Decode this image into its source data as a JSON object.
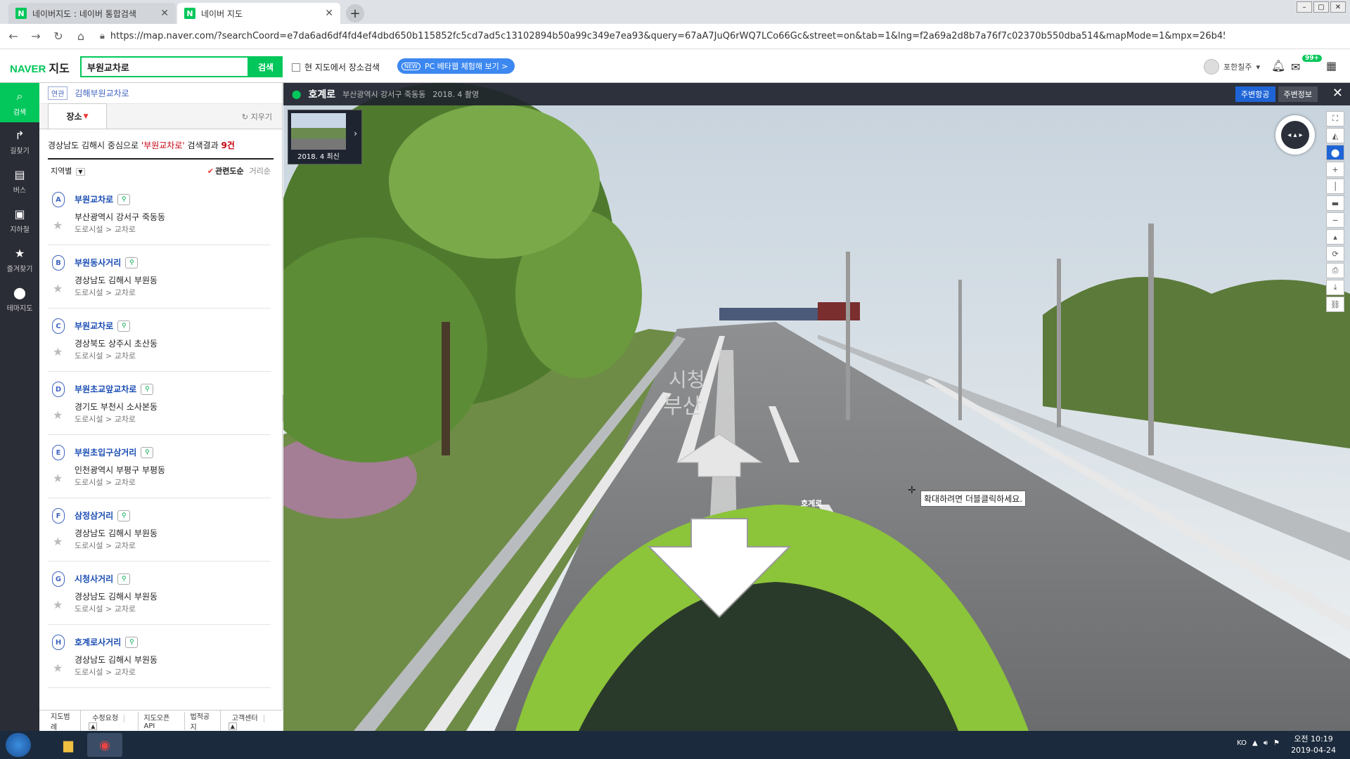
{
  "browser": {
    "tabs": [
      {
        "title": "네이버지도 : 네이버 통합검색",
        "active": false
      },
      {
        "title": "네이버 지도",
        "active": true
      }
    ],
    "url": "https://map.naver.com/?searchCoord=e7da6ad6df4fd4ef4dbd650b115852fc5cd7ad5c13102894b50a99c349e7ea93&query=67aA7JuQ6rWQ7LCo66Gc&street=on&tab=1&lng=f2a69a2d8b7a76f7c02370b550dba514&mapMode=1&mpx=26b45c..."
  },
  "header": {
    "logo": "NAVER",
    "logo_suffix": "지도",
    "search_value": "부원교차로",
    "search_button": "검색",
    "checkbox_label": "현 지도에서 장소검색",
    "beta_badge": "NEW",
    "beta_label": "PC 베타웹 체험해 보기 >",
    "user_name": "포한칠주",
    "mail_badge": "99+"
  },
  "leftnav": [
    {
      "icon": "search-icon",
      "glyph": "⌕",
      "label": "검색"
    },
    {
      "icon": "directions-icon",
      "glyph": "↱",
      "label": "길찾기"
    },
    {
      "icon": "bus-icon",
      "glyph": "▤",
      "label": "버스"
    },
    {
      "icon": "subway-icon",
      "glyph": "▣",
      "label": "지하철"
    },
    {
      "icon": "star-icon",
      "glyph": "★",
      "label": "즐겨찾기"
    },
    {
      "icon": "pin-icon",
      "glyph": "⬤",
      "label": "테마지도"
    }
  ],
  "panel": {
    "related_tag": "연관",
    "related_text": "김해부원교차로",
    "tab_label": "장소",
    "clear_label": "지우기",
    "summary_prefix": "경상남도 김해시 중심으로 ",
    "summary_query": "'부원교차로'",
    "summary_mid": " 검색결과 ",
    "summary_count": "9건",
    "filter_label": "지역별",
    "sort_relevance": "관련도순",
    "sort_distance": "거리순",
    "results": [
      {
        "marker": "A",
        "name": "부원교차로",
        "address": "부산광역시 강서구 죽동동",
        "category": "도로시설 > 교차로"
      },
      {
        "marker": "B",
        "name": "부원동사거리",
        "address": "경상남도 김해시 부원동",
        "category": "도로시설 > 교차로"
      },
      {
        "marker": "C",
        "name": "부원교차로",
        "address": "경상북도 상주시 초산동",
        "category": "도로시설 > 교차로"
      },
      {
        "marker": "D",
        "name": "부원초교앞교차로",
        "address": "경기도 부천시 소사본동",
        "category": "도로시설 > 교차로"
      },
      {
        "marker": "E",
        "name": "부원초입구삼거리",
        "address": "인천광역시 부평구 부평동",
        "category": "도로시설 > 교차로"
      },
      {
        "marker": "F",
        "name": "삼정삼거리",
        "address": "경상남도 김해시 부원동",
        "category": "도로시설 > 교차로"
      },
      {
        "marker": "G",
        "name": "시청사거리",
        "address": "경상남도 김해시 부원동",
        "category": "도로시설 > 교차로"
      },
      {
        "marker": "H",
        "name": "호계로사거리",
        "address": "경상남도 김해시 부원동",
        "category": "도로시설 > 교차로"
      }
    ],
    "footer_links": [
      "지도범례",
      "수정요청",
      "지도오픈API",
      "법적공지",
      "고객센터"
    ]
  },
  "streetview": {
    "road_name": "호계로",
    "address": "부산광역시 강서구 죽동동",
    "date": "2018. 4 촬영",
    "btn_nearby_aviation": "주변항공",
    "btn_nearby_info": "주변정보",
    "thumb_label": "2018. 4 최신",
    "tooltip": "확대하려면 더블클릭하세요.",
    "road_marker": "호계로",
    "painted_text": [
      "시청",
      "부산"
    ]
  },
  "taskbar": {
    "lang": "KO",
    "time": "오전 10:19",
    "date": "2019-04-24"
  }
}
